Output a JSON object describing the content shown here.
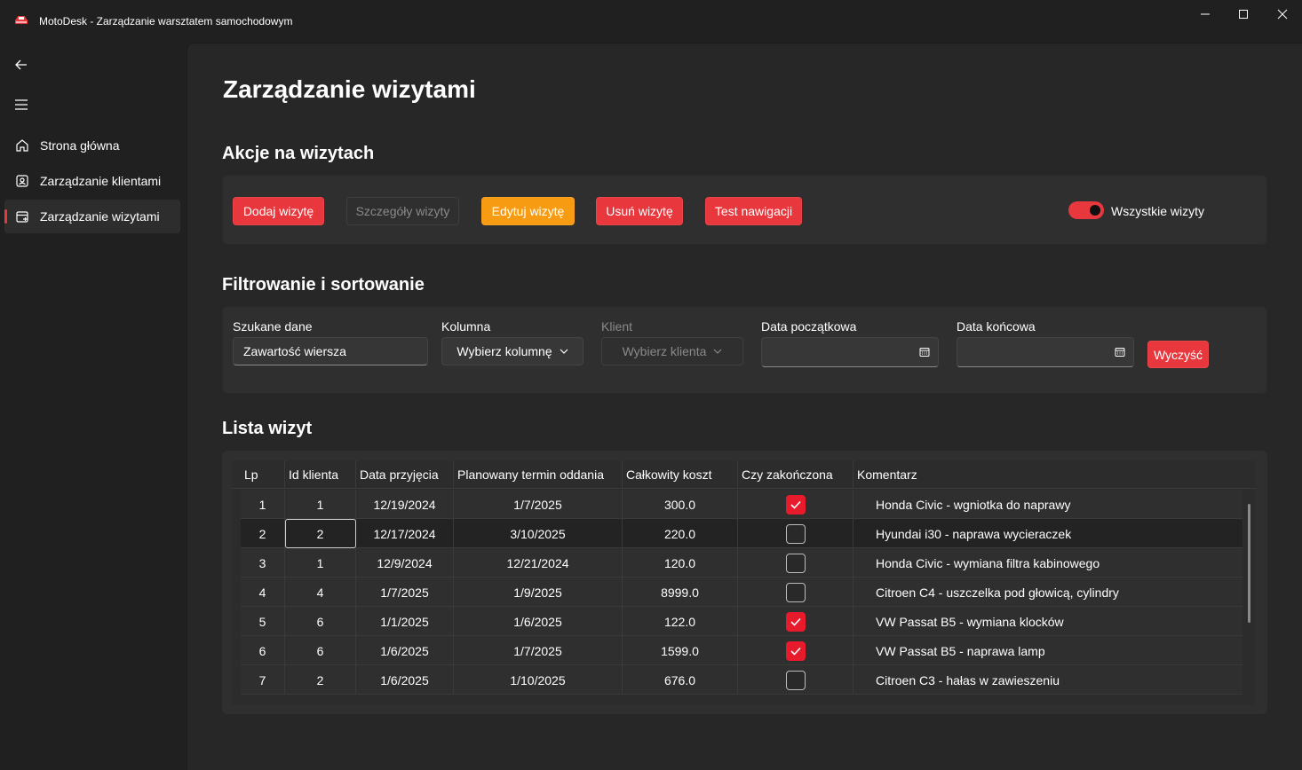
{
  "window": {
    "title": "MotoDesk - Zarządzanie warsztatem samochodowym",
    "minimize": "—",
    "maximize": "☐",
    "close": "✕"
  },
  "nav": {
    "back_icon": "back-arrow-icon",
    "menu_icon": "hamburger-icon",
    "items": [
      {
        "label": "Strona główna",
        "icon": "home-icon"
      },
      {
        "label": "Zarządzanie klientami",
        "icon": "contact-icon"
      },
      {
        "label": "Zarządzanie wizytami",
        "icon": "calendar-icon",
        "selected": true
      }
    ]
  },
  "page": {
    "title": "Zarządzanie wizytami"
  },
  "actions": {
    "title": "Akcje na wizytach",
    "add": "Dodaj wizytę",
    "details": "Szczegóły wizyty",
    "edit": "Edytuj wizytę",
    "delete": "Usuń wizytę",
    "test": "Test nawigacji",
    "toggle_label": "Wszystkie wizyty",
    "toggle_on": true
  },
  "filters": {
    "title": "Filtrowanie i sortowanie",
    "search_label": "Szukane dane",
    "search_placeholder": "Zawartość wiersza",
    "column_label": "Kolumna",
    "column_value": "Wybierz kolumnę",
    "client_label": "Klient",
    "client_value": "Wybierz klienta",
    "start_label": "Data początkowa",
    "end_label": "Data końcowa",
    "clear": "Wyczyść"
  },
  "list": {
    "title": "Lista wizyt",
    "columns": [
      "Lp",
      "Id klienta",
      "Data przyjęcia",
      "Planowany termin oddania",
      "Całkowity koszt",
      "Czy zakończona",
      "Komentarz"
    ],
    "rows": [
      {
        "lp": "1",
        "client": "1",
        "received": "12/19/2024",
        "due": "1/7/2025",
        "cost": "300.0",
        "done": true,
        "comment": "Honda Civic - wgniotka do naprawy"
      },
      {
        "lp": "2",
        "client": "2",
        "received": "12/17/2024",
        "due": "3/10/2025",
        "cost": "220.0",
        "done": false,
        "comment": "Hyundai i30 - naprawa wycieraczek"
      },
      {
        "lp": "3",
        "client": "1",
        "received": "12/9/2024",
        "due": "12/21/2024",
        "cost": "120.0",
        "done": false,
        "comment": "Honda Civic - wymiana filtra kabinowego"
      },
      {
        "lp": "4",
        "client": "4",
        "received": "1/7/2025",
        "due": "1/9/2025",
        "cost": "8999.0",
        "done": false,
        "comment": "Citroen C4 - uszczelka pod głowicą, cylindry"
      },
      {
        "lp": "5",
        "client": "6",
        "received": "1/1/2025",
        "due": "1/6/2025",
        "cost": "122.0",
        "done": true,
        "comment": "VW Passat B5 - wymiana klocków"
      },
      {
        "lp": "6",
        "client": "6",
        "received": "1/6/2025",
        "due": "1/7/2025",
        "cost": "1599.0",
        "done": true,
        "comment": "VW Passat B5 - naprawa lamp"
      },
      {
        "lp": "7",
        "client": "2",
        "received": "1/6/2025",
        "due": "1/10/2025",
        "cost": "676.0",
        "done": false,
        "comment": "Citroen C3 - hałas w zawieszeniu"
      }
    ]
  },
  "colors": {
    "accent_red": "#e8373d",
    "accent_orange": "#f79b12",
    "checkbox_red": "#e81b2c"
  }
}
